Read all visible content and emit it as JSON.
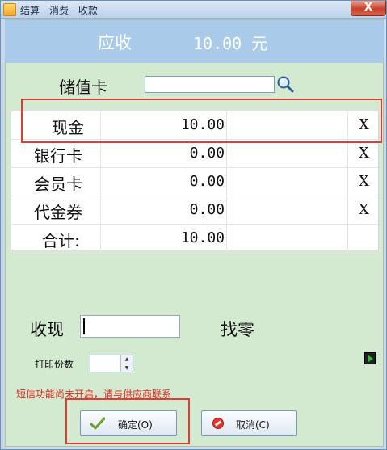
{
  "window": {
    "title": "结算 - 消费 - 收款",
    "close_label": "X",
    "icon_label": ""
  },
  "due": {
    "label": "应收",
    "amount": "10.00 元"
  },
  "stored_value": {
    "label": "储值卡",
    "input_value": ""
  },
  "payments": [
    {
      "name": "现金",
      "amount": "10.00",
      "remove": "X"
    },
    {
      "name": "银行卡",
      "amount": "0.00",
      "remove": "X"
    },
    {
      "name": "会员卡",
      "amount": "0.00",
      "remove": "X"
    },
    {
      "name": "代金券",
      "amount": "0.00",
      "remove": "X"
    },
    {
      "name": "合计:",
      "amount": "10.00",
      "remove": ""
    }
  ],
  "received": {
    "label": "收现",
    "value": ""
  },
  "change": {
    "label": "找零"
  },
  "print": {
    "label": "打印份数",
    "value": ""
  },
  "sms_warning": "短信功能尚未开启，请与供应商联系",
  "buttons": {
    "ok": "确定(O)",
    "cancel": "取消(C)"
  },
  "colors": {
    "header_bar": "#a9cbe9",
    "client_bg": "#d3ead1",
    "highlight": "#e23b32",
    "warning_text": "#e0271c"
  }
}
